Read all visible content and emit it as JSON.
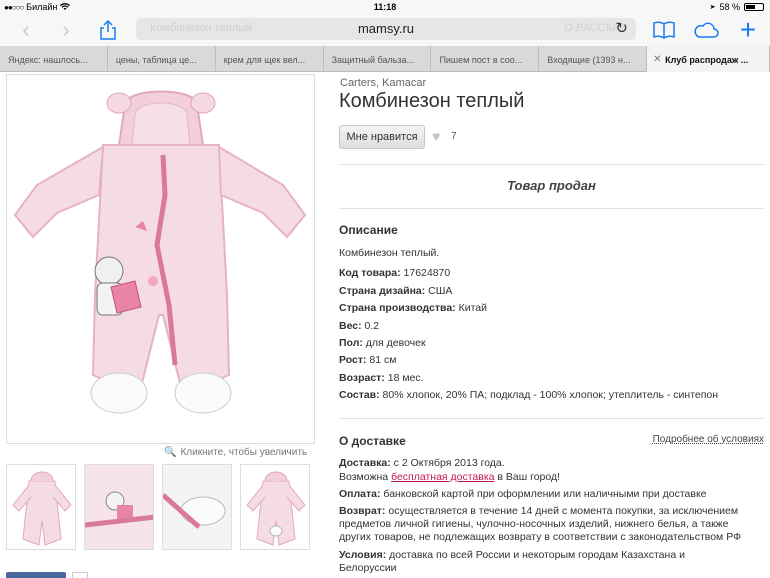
{
  "status_bar": {
    "carrier": "Билайн",
    "time": "11:18",
    "battery": "58 %",
    "battery_level": 0.58
  },
  "toolbar": {
    "host": "mamsy.ru",
    "ghost_left": "Комбинезон теплый",
    "ghost_right": "О РАССКАЗ"
  },
  "tabs": [
    {
      "label": "Яндекс: нашлось..."
    },
    {
      "label": "цены, таблица це..."
    },
    {
      "label": "крем для щек вел..."
    },
    {
      "label": "Защитный бальза..."
    },
    {
      "label": "Пишем пост в соо..."
    },
    {
      "label": "Входящие (1393 н..."
    },
    {
      "label": "Клуб распродаж ..."
    }
  ],
  "gallery": {
    "zoom_hint": "Кликните, чтобы увеличить"
  },
  "product": {
    "brand": "Carters, Kamacar",
    "title": "Комбинезон теплый",
    "like_label": "Мне нравится",
    "like_count": "7",
    "sold_label": "Товар продан"
  },
  "description": {
    "title": "Описание",
    "text": "Комбинезон теплый.",
    "fields": [
      {
        "label": "Код товара:",
        "value": " 17624870"
      },
      {
        "label": "Страна дизайна:",
        "value": " США"
      },
      {
        "label": "Страна производства:",
        "value": " Китай"
      },
      {
        "label": "Вес:",
        "value": " 0.2"
      },
      {
        "label": "Пол:",
        "value": " для девочек"
      },
      {
        "label": "Рост:",
        "value": " 81 см"
      },
      {
        "label": "Возраст:",
        "value": " 18 мес."
      },
      {
        "label": "Состав:",
        "value": " 80% хлопок, 20% ПА; подклад - 100% хлопок; утеплитель - синтепон"
      }
    ]
  },
  "delivery": {
    "title": "О доставке",
    "more_link": "Подробнее об условиях",
    "date_label": "Доставка:",
    "date_value": " с 2 Октября 2013 года.",
    "free_prefix": "Возможна ",
    "free_link": "бесплатная доставка",
    "free_suffix": " в Ваш город!",
    "payment_label": "Оплата:",
    "payment_value": " банковской картой при оформлении или наличными при доставке",
    "return_label": "Возврат:",
    "return_line1": " осуществляется в течение 14 дней с момента покупки, за исключением",
    "return_line2": "предметов личной гигиены, чулочно-носочных изделий, нижнего белья, а также",
    "return_line3": "других товаров, не подлежащих возврату в соответствии с законодательством РФ",
    "terms_label": "Условия:",
    "terms_line1": " доставка по всей России и некоторым городам Казахстана и",
    "terms_line2": "Белоруссии"
  }
}
